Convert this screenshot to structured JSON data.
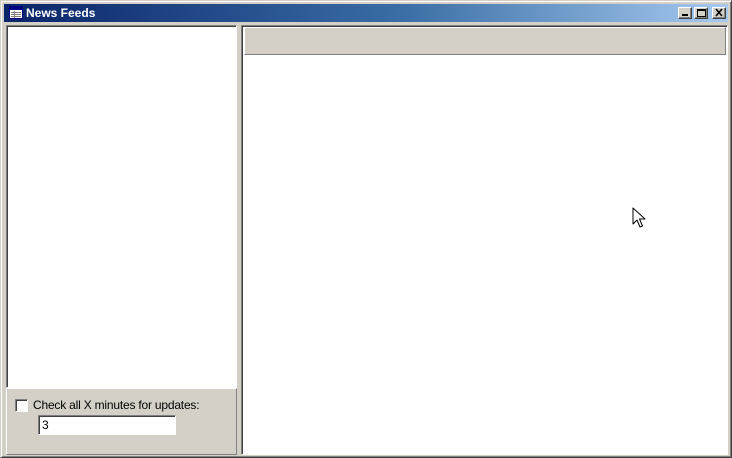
{
  "window": {
    "title": "News Feeds",
    "icons": {
      "app": "window-list-icon",
      "minimize": "minimize-icon",
      "maximize": "maximize-icon",
      "close": "close-icon"
    }
  },
  "sidebar": {
    "feeds": [],
    "options": {
      "update_checkbox_label": "Check all X minutes for updates:",
      "update_checked": false,
      "interval_value": "3"
    }
  },
  "content": {
    "header_text": "",
    "body_text": ""
  },
  "colors": {
    "titlebar_start": "#0a246a",
    "titlebar_end": "#a6caf0",
    "face": "#d4d0c8"
  }
}
